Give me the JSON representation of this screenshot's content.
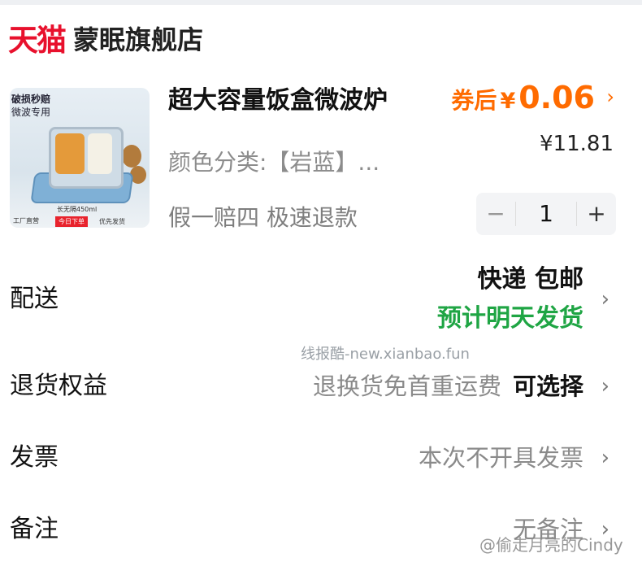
{
  "shop": {
    "platform_logo": "天猫",
    "name": "蒙眠旗舰店"
  },
  "product": {
    "title": "超大容量饭盒微波炉",
    "variant": "颜色分类:【岩蓝】...",
    "guarantee": "假一赔四  极速退款",
    "image": {
      "tag_line1": "破损秒赔",
      "tag_line2": "微波专用",
      "caption_size": "长无隔450ml",
      "badge": "今日下单",
      "caption_ship": "优先发货",
      "caption_factory": "工厂直营"
    },
    "coupon_prefix": "券后",
    "currency": "¥",
    "coupon_price": "0.06",
    "original_price": "¥11.81",
    "quantity": "1"
  },
  "delivery": {
    "label": "配送",
    "method": "快递 包邮",
    "estimate": "预计明天发货",
    "estimate_color": "#1fa544"
  },
  "watermark": "线报酷-new.xianbao.fun",
  "returns": {
    "label": "退货权益",
    "value": "退换货免首重运费",
    "action": "可选择"
  },
  "invoice": {
    "label": "发票",
    "value": "本次不开具发票"
  },
  "note": {
    "label": "备注",
    "value": "无备注"
  },
  "corner_watermark": "@偷走月亮的Cindy",
  "icons": {
    "chevron": "chevron-right-icon",
    "minus": "minus-icon",
    "plus": "plus-icon"
  },
  "colors": {
    "brand": "#e8112d",
    "price": "#ff6b00",
    "green": "#1fa544"
  }
}
